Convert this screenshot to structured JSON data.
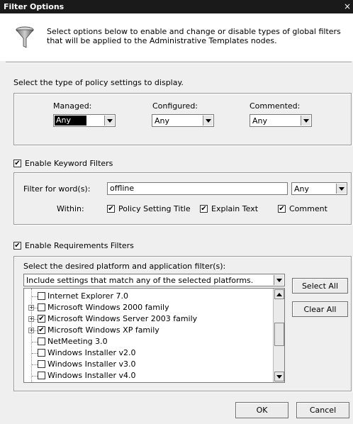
{
  "dialog": {
    "title": "Filter Options",
    "close_glyph": "×",
    "description": "Select options below to enable and change or disable types of global filters that will be applied to the Administrative Templates nodes."
  },
  "policy_type": {
    "heading": "Select the type of policy settings to display.",
    "managed_label": "Managed:",
    "managed_value": "Any",
    "configured_label": "Configured:",
    "configured_value": "Any",
    "commented_label": "Commented:",
    "commented_value": "Any"
  },
  "keyword": {
    "enable_label": "Enable Keyword Filters",
    "enabled": true,
    "filter_label": "Filter for word(s):",
    "filter_value": "offline",
    "match_value": "Any",
    "within_label": "Within:",
    "policy_title_label": "Policy Setting Title",
    "policy_title_checked": true,
    "explain_label": "Explain Text",
    "explain_checked": true,
    "comment_label": "Comment",
    "comment_checked": true
  },
  "requirements": {
    "enable_label": "Enable Requirements Filters",
    "enabled": true,
    "platform_heading": "Select the desired platform and application filter(s):",
    "match_mode": "Include settings that match any of the selected platforms.",
    "select_all_label": "Select All",
    "clear_all_label": "Clear All",
    "items": [
      {
        "label": "Internet Explorer 7.0",
        "checked": false,
        "expandable": false
      },
      {
        "label": "Microsoft Windows 2000 family",
        "checked": false,
        "expandable": true
      },
      {
        "label": "Microsoft Windows Server 2003 family",
        "checked": true,
        "expandable": true
      },
      {
        "label": "Microsoft Windows XP family",
        "checked": true,
        "expandable": true
      },
      {
        "label": "NetMeeting 3.0",
        "checked": false,
        "expandable": false
      },
      {
        "label": "Windows Installer v2.0",
        "checked": false,
        "expandable": false
      },
      {
        "label": "Windows Installer v3.0",
        "checked": false,
        "expandable": false
      },
      {
        "label": "Windows Installer v4.0",
        "checked": false,
        "expandable": false
      }
    ]
  },
  "footer": {
    "ok_label": "OK",
    "cancel_label": "Cancel"
  },
  "icons": {
    "funnel": "filter-funnel-icon",
    "check": "✔",
    "expand": "+"
  }
}
